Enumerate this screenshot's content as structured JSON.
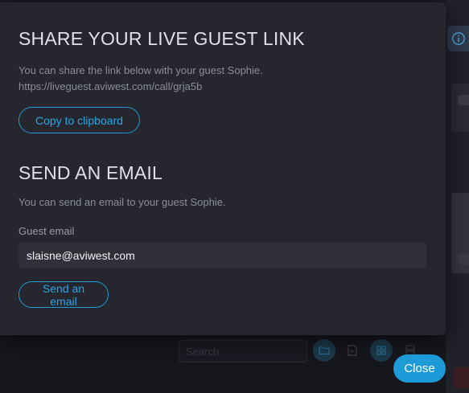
{
  "share": {
    "title": "SHARE YOUR LIVE GUEST LINK",
    "description": "You can share the link below with your guest Sophie.",
    "link": "https://liveguest.aviwest.com/call/grja5b",
    "copy_button": "Copy to clipboard"
  },
  "email": {
    "title": "SEND AN EMAIL",
    "description": "You can send an email to your guest Sophie.",
    "field_label": "Guest email",
    "field_value": "slaisne@aviwest.com",
    "send_button": "Send an email"
  },
  "close_button": "Close",
  "background": {
    "search_placeholder": "Search"
  },
  "colors": {
    "accent": "#1d9ad8",
    "modal_bg": "#25262e",
    "page_bg": "#1b1c23"
  },
  "icons": [
    "info-icon",
    "folder-icon",
    "media-icon",
    "grid-icon",
    "layout-icon"
  ]
}
